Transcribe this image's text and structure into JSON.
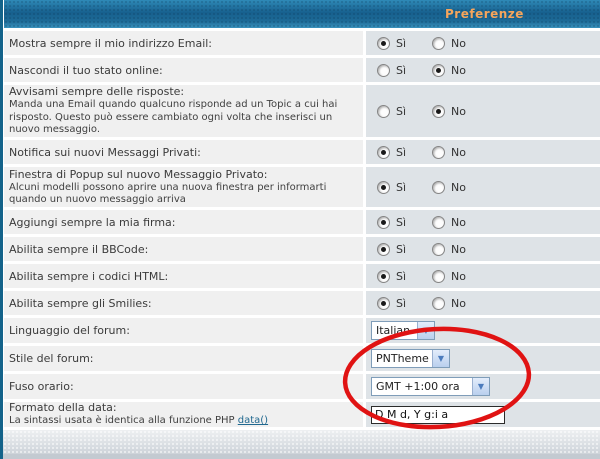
{
  "header": {
    "title": "Preferenze"
  },
  "options": {
    "yes": "Sì",
    "no": "No"
  },
  "rows": [
    {
      "label": "Mostra sempre il mio indirizzo Email:",
      "type": "radio",
      "selected": "yes"
    },
    {
      "label": "Nascondi il tuo stato online:",
      "type": "radio",
      "selected": "no"
    },
    {
      "label": "Avvisami sempre delle risposte:",
      "sub": "Manda una Email quando qualcuno risponde ad un Topic a cui hai risposto. Questo può essere cambiato ogni volta che inserisci un nuovo messaggio.",
      "type": "radio",
      "selected": "no"
    },
    {
      "label": "Notifica sui nuovi Messaggi Privati:",
      "type": "radio",
      "selected": "yes"
    },
    {
      "label": "Finestra di Popup sul nuovo Messaggio Privato:",
      "sub": "Alcuni modelli possono aprire una nuova finestra per informarti quando un nuovo messaggio arriva",
      "type": "radio",
      "selected": "yes"
    },
    {
      "label": "Aggiungi sempre la mia firma:",
      "type": "radio",
      "selected": "yes"
    },
    {
      "label": "Abilita sempre il BBCode:",
      "type": "radio",
      "selected": "yes"
    },
    {
      "label": "Abilita sempre i codici HTML:",
      "type": "radio",
      "selected": "yes"
    },
    {
      "label": "Abilita sempre gli Smilies:",
      "type": "radio",
      "selected": "yes"
    },
    {
      "label": "Linguaggio del forum:",
      "type": "select",
      "value": "Italian"
    },
    {
      "label": "Stile del forum:",
      "type": "select",
      "value": "PNTheme"
    },
    {
      "label": "Fuso orario:",
      "type": "select",
      "value": "GMT +1:00 ora"
    },
    {
      "label": "Formato della data:",
      "sub_prefix": "La sintassi usata è identica alla funzione PHP ",
      "sub_link": "data()",
      "type": "text",
      "value": "D M d, Y g:i a"
    }
  ],
  "annotation": {
    "shape": "ellipse",
    "color": "#e01313"
  },
  "colors": {
    "header_accent": "#f6a55c",
    "link": "#20688f",
    "left_cell": "#f0f0f0",
    "right_cell": "#dee3e7",
    "side_border": "#14638a"
  }
}
